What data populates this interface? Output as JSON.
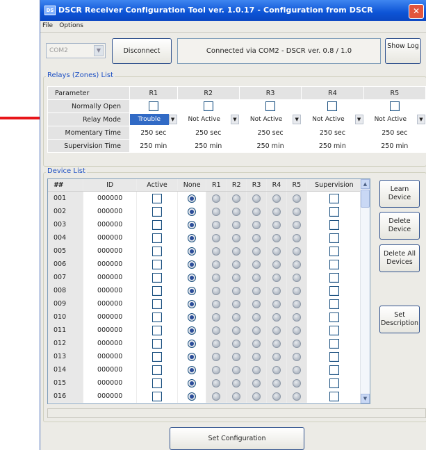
{
  "window": {
    "title": "DSCR Receiver Configuration Tool ver. 1.0.17 - Configuration from DSCR",
    "icon_text": "DS",
    "close_glyph": "✕"
  },
  "menu": [
    "File",
    "Options"
  ],
  "connection": {
    "port_value": "COM2",
    "disconnect_label": "Disconnect",
    "status_text": "Connected via COM2 - DSCR ver. 0.8 / 1.0",
    "show_log_label": "Show Log"
  },
  "relays": {
    "group_label": "Relays (Zones) List",
    "header_param": "Parameter",
    "columns": [
      "R1",
      "R2",
      "R3",
      "R4",
      "R5"
    ],
    "row_labels": {
      "normally_open": "Normally Open",
      "relay_mode": "Relay Mode",
      "momentary_time": "Momentary Time",
      "supervision_time": "Supervision Time"
    },
    "relay_mode_values": [
      "Trouble",
      "Not Active",
      "Not Active",
      "Not Active",
      "Not Active"
    ],
    "momentary_values": [
      "250 sec",
      "250 sec",
      "250 sec",
      "250 sec",
      "250 sec"
    ],
    "supervision_values": [
      "250 min",
      "250 min",
      "250 min",
      "250 min",
      "250 min"
    ]
  },
  "devices": {
    "group_label": "Device List",
    "headers": [
      "##",
      "ID",
      "Active",
      "None",
      "R1",
      "R2",
      "R3",
      "R4",
      "R5",
      "Supervision"
    ],
    "rows": [
      {
        "num": "001",
        "id": "000000"
      },
      {
        "num": "002",
        "id": "000000"
      },
      {
        "num": "003",
        "id": "000000"
      },
      {
        "num": "004",
        "id": "000000"
      },
      {
        "num": "005",
        "id": "000000"
      },
      {
        "num": "006",
        "id": "000000"
      },
      {
        "num": "007",
        "id": "000000"
      },
      {
        "num": "008",
        "id": "000000"
      },
      {
        "num": "009",
        "id": "000000"
      },
      {
        "num": "010",
        "id": "000000"
      },
      {
        "num": "011",
        "id": "000000"
      },
      {
        "num": "012",
        "id": "000000"
      },
      {
        "num": "013",
        "id": "000000"
      },
      {
        "num": "014",
        "id": "000000"
      },
      {
        "num": "015",
        "id": "000000"
      },
      {
        "num": "016",
        "id": "000000"
      }
    ]
  },
  "side_buttons": {
    "learn": "Learn Device",
    "delete": "Delete Device",
    "delete_all": "Delete All Devices",
    "set_description": "Set Description"
  },
  "set_configuration_label": "Set Configuration",
  "colors": {
    "annotation_arrow": "#e8151a",
    "selected_cell": "#316ac5",
    "titlebar": "#0d54d6"
  }
}
